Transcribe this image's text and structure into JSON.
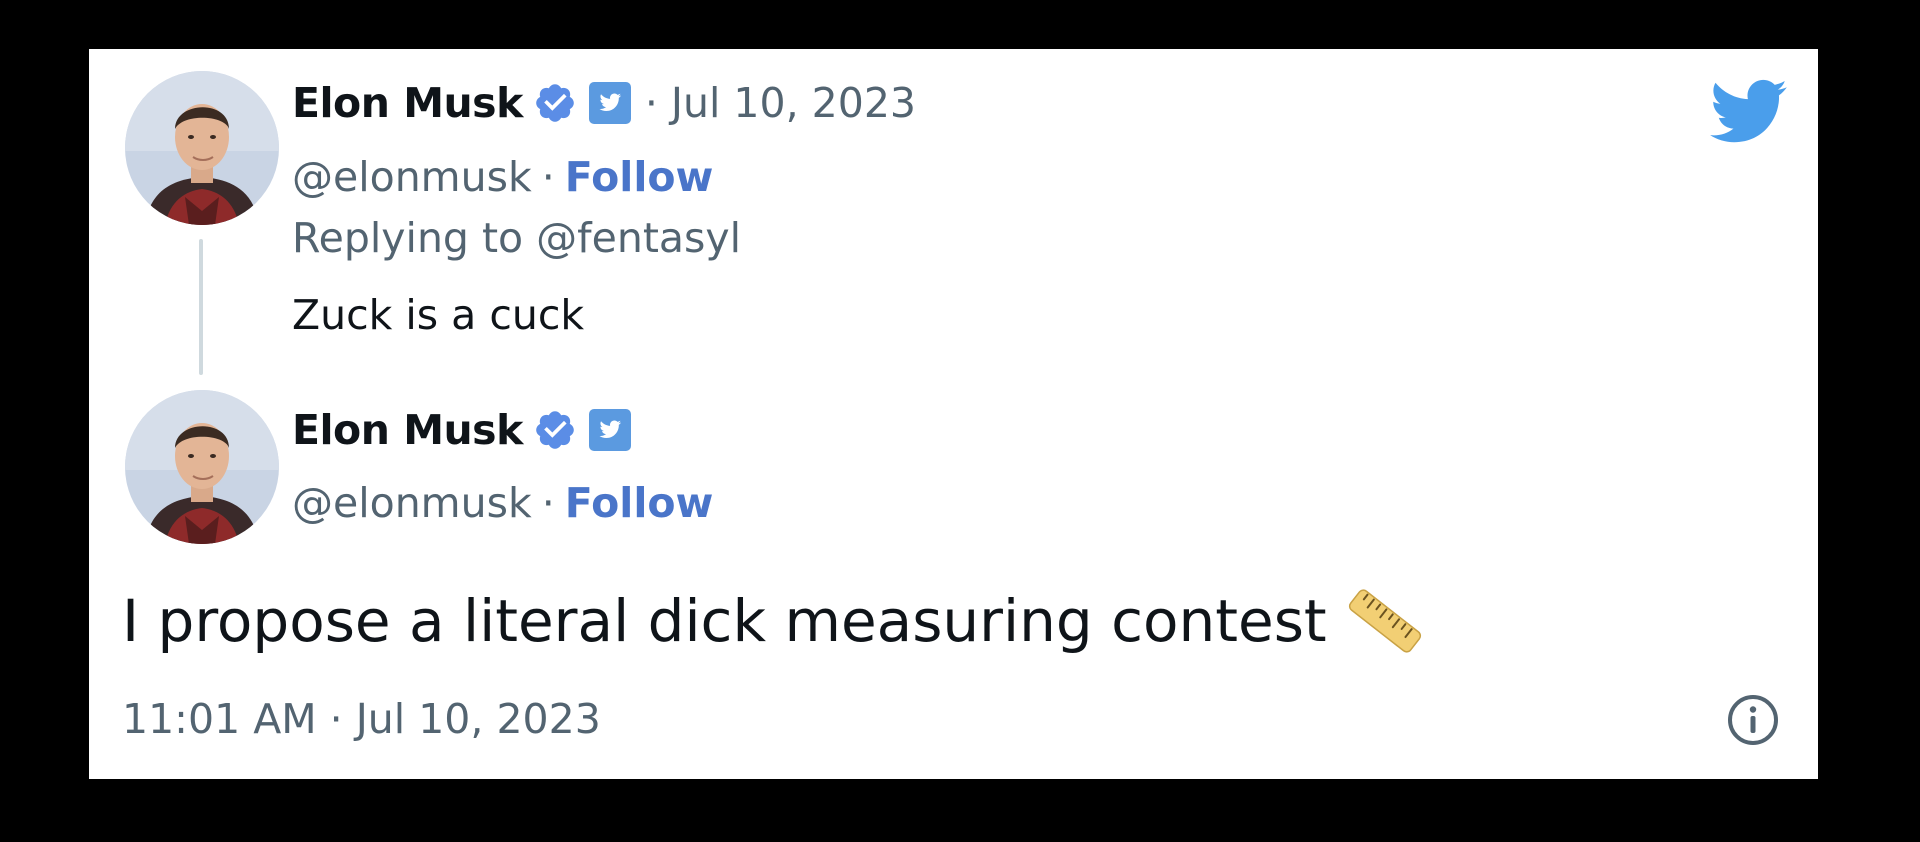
{
  "parent_tweet": {
    "author_name": "Elon Musk",
    "date_label": "· Jul 10, 2023",
    "handle": "@elonmusk",
    "separator": "·",
    "follow_label": "Follow",
    "replying_to": "Replying to @fentasyl",
    "text": "Zuck is a cuck",
    "icons": [
      "verified-badge-icon",
      "twitter-square-icon"
    ]
  },
  "main_tweet": {
    "author_name": "Elon Musk",
    "handle": "@elonmusk",
    "separator": "·",
    "follow_label": "Follow",
    "text": "I propose a literal dick measuring contest",
    "emoji": "straight-ruler-emoji",
    "timestamp": "11:01 AM · Jul 10, 2023",
    "icons": [
      "verified-badge-icon",
      "twitter-square-icon"
    ]
  },
  "card_icons": [
    "twitter-bird-icon",
    "info-icon"
  ],
  "colors": {
    "background": "#000000",
    "card": "#ffffff",
    "text": "#0f1419",
    "secondary_text": "#536471",
    "follow_link": "#4a75c9",
    "verified_badge": "#5b8de6",
    "twitter_blue": "#4a9eeb",
    "thread_line": "#cfd9de"
  }
}
